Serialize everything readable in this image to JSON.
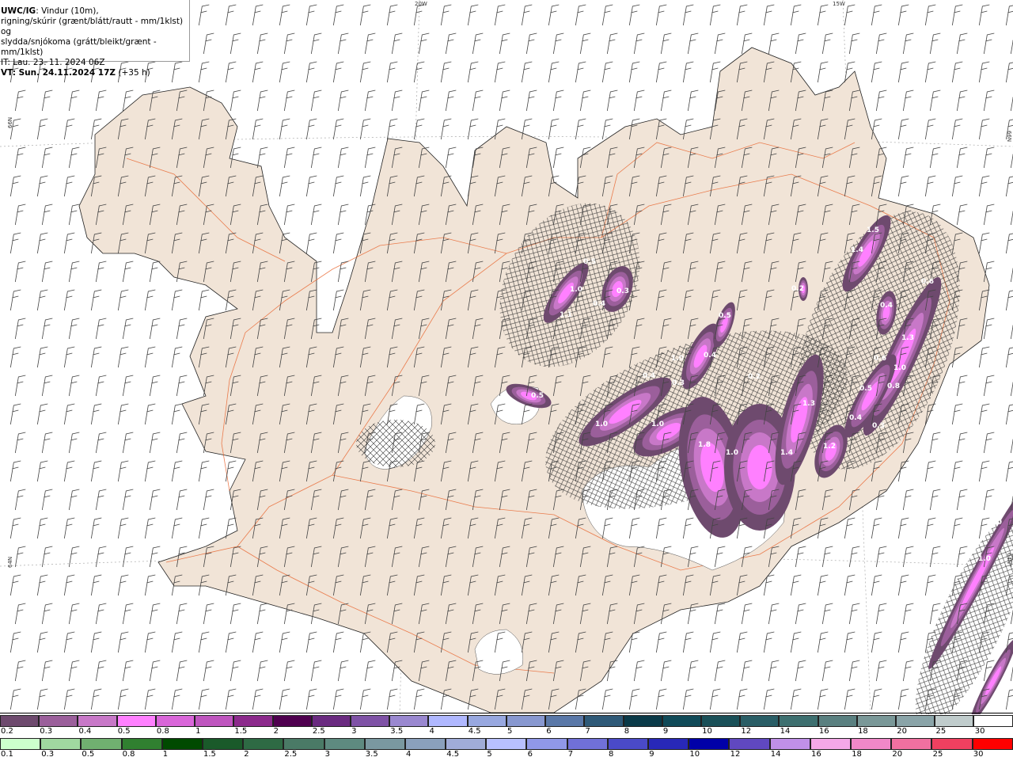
{
  "title": {
    "model": "UWC/IG",
    "line1_rest": ": Vindur (10m),",
    "line2": "rigning/skúrir (grænt/blátt/rautt - mm/1klst) og",
    "line3": "slydda/snjókoma (grátt/bleikt/grænt - mm/1klst)",
    "issue_time": "IT: Lau. 23. 11. 2024 06Z",
    "valid_time": "VT: Sun. 24.11.2024 17Z",
    "lead": " (+35 h)"
  },
  "grid_labels": {
    "lon_20w": "20W",
    "lon_15w": "15W",
    "lat_66n_left": "66N",
    "lat_66n_right": "66N",
    "lat_64n_left": "64N",
    "lat_64n_right": "64N"
  },
  "contour_labels": [
    "0.5",
    "1.0",
    "1.1",
    "0.4",
    "0.3",
    "0.5",
    "0.4",
    "1.0",
    "0.4",
    "0.3",
    "0.5",
    "1.0",
    "1.0",
    "1.8",
    "1.0",
    "1.4",
    "1.3",
    "1.2",
    "0.2",
    "1.5",
    "1.4",
    "0.4",
    "0.6",
    "1.3",
    "1.0",
    "0.8",
    "0.6",
    "0.5",
    "0.4",
    "0.3",
    "1.0",
    "1.0",
    "0.2"
  ],
  "legend_snow": {
    "labels": [
      "0.2",
      "0.3",
      "0.4",
      "0.5",
      "0.8",
      "1",
      "1.5",
      "2",
      "2.5",
      "3",
      "3.5",
      "4",
      "4.5",
      "5",
      "6",
      "7",
      "8",
      "9",
      "10",
      "12",
      "14",
      "16",
      "18",
      "20",
      "25",
      "30"
    ],
    "colors": [
      "#6e4a6e",
      "#9b5f9b",
      "#c878c8",
      "#ff80ff",
      "#d966d9",
      "#bf55bf",
      "#8c2a8c",
      "#4f004f",
      "#6a2a80",
      "#7f52a6",
      "#9a88d0",
      "#b0b8ff",
      "#98a8e0",
      "#8898d0",
      "#5a78a8",
      "#2f5a78",
      "#0a3a48",
      "#104a58",
      "#1a5058",
      "#2a5e66",
      "#3e7070",
      "#5a8080",
      "#7a9898",
      "#8aa4a8",
      "#c0cccc",
      "#ffffff"
    ]
  },
  "legend_rain": {
    "labels": [
      "0.1",
      "0.3",
      "0.5",
      "0.8",
      "1",
      "1.5",
      "2",
      "2.5",
      "3",
      "3.5",
      "4",
      "4.5",
      "5",
      "6",
      "7",
      "8",
      "9",
      "10",
      "12",
      "14",
      "16",
      "18",
      "20",
      "25",
      "30"
    ],
    "colors": [
      "#ccffcc",
      "#a0d8a0",
      "#70b070",
      "#308030",
      "#004a00",
      "#1a5a2a",
      "#2e6a44",
      "#4a7a66",
      "#5e8a80",
      "#7a98a0",
      "#8aa0bc",
      "#a0acd8",
      "#b8c0ff",
      "#9098e8",
      "#7070d8",
      "#4a4ac8",
      "#2828b8",
      "#0000a8",
      "#6048c0",
      "#c090e8",
      "#f4a8e8",
      "#f088c8",
      "#f070a0",
      "#f04060",
      "#ff0000"
    ]
  },
  "colors": {
    "land": "#f1e4d7",
    "roads": "#e8622a",
    "glacier": "#ffffff",
    "ocean": "#ffffff"
  }
}
